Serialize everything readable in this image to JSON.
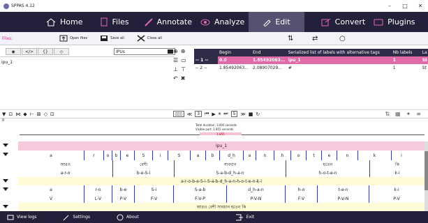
{
  "app": {
    "title": "SPPAS 4.12"
  },
  "menu": [
    {
      "label": "Home",
      "icon": "home-icon"
    },
    {
      "label": "Files",
      "icon": "files-icon"
    },
    {
      "label": "Annotate",
      "icon": "annotate-icon"
    },
    {
      "label": "Analyze",
      "icon": "analyze-icon"
    },
    {
      "label": "Edit",
      "icon": "edit-icon"
    },
    {
      "label": "Convert",
      "icon": "convert-icon"
    },
    {
      "label": "Plugins",
      "icon": "plugins-icon"
    }
  ],
  "toolbar": {
    "files_label": "Files:",
    "open": "Open files",
    "save": "Save all",
    "close": "Close all"
  },
  "tierpanel": {
    "selected_tier": "IPUs",
    "tier_name": "ipu_1"
  },
  "annotations": {
    "headers": [
      "",
      "Begin",
      "End",
      "Serialized list of labels with alternative tags",
      "Nb labels",
      "La"
    ],
    "rows": [
      [
        "-- 1 --",
        "0.0",
        "1.85492063...",
        "ipu_1",
        "1",
        "St"
      ],
      [
        "-- 2 --",
        "1.85492063...",
        "2.08907029...",
        "#",
        "1",
        "St"
      ]
    ]
  },
  "player": {
    "ch": "3",
    "speed": "5"
  },
  "info": {
    "zero": "0",
    "total": "Total duration: 3.000 seconds",
    "visible": "Visible part: 1.855 seconds",
    "sel": "1.855"
  },
  "tiers": {
    "ipu": "ipu_1",
    "tokens": [
      "a",
      "r",
      "o",
      "b",
      "e",
      "S",
      "i",
      "S",
      "a",
      "b",
      "d_h",
      "a",
      "n",
      "h",
      "o",
      "t",
      "e",
      "n",
      "k",
      "i"
    ],
    "words_bn": [
      "আরও",
      "বেশী",
      "সাবধান",
      "হতেন",
      "কি"
    ],
    "words_pr": [
      "a-r-o",
      "b-e-S-i",
      "S-a-b-d_h-a-n",
      "h-o-t-e-n",
      "k-i"
    ],
    "ipu_pr": "a-r-o-b-e-S-i-S-a-b-d_h-a-n-h-o-t-e-n-k-i",
    "syll": [
      "a",
      "r-o",
      "b-e",
      "S-i",
      "S-a-b",
      "d_h-a-n",
      "h-o",
      "t-e-n",
      "k-i"
    ],
    "cv": [
      "V",
      "L-V",
      "P-V",
      "F-V",
      "F-V-P",
      "P-V-N",
      "F-V",
      "P-V-N",
      "P-V"
    ],
    "sentence": "আরও বেশী সাবধান হতেন কি"
  },
  "status": {
    "logs": "View logs",
    "settings": "Settings",
    "about": "About",
    "exit": "Exit"
  }
}
